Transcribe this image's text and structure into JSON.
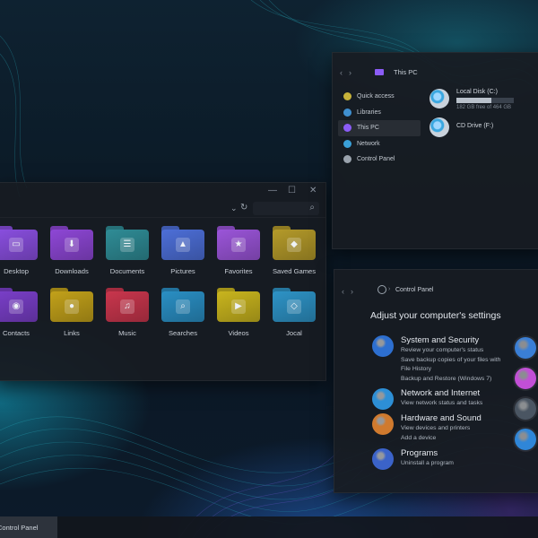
{
  "explorer": {
    "folders": [
      {
        "label": "Desktop",
        "color": "#8a4fe0",
        "glyph": "▭"
      },
      {
        "label": "Downloads",
        "color": "#8e47d6",
        "glyph": "⬇"
      },
      {
        "label": "Documents",
        "color": "#2f8c96",
        "glyph": "☰"
      },
      {
        "label": "Pictures",
        "color": "#4d6fd8",
        "glyph": "▲"
      },
      {
        "label": "Favorites",
        "color": "#9b55d9",
        "glyph": "★"
      },
      {
        "label": "Saved Games",
        "color": "#b49a2a",
        "glyph": "◆"
      },
      {
        "label": "Contacts",
        "color": "#7a3fc9",
        "glyph": "◉"
      },
      {
        "label": "Links",
        "color": "#c2a11a",
        "glyph": "●"
      },
      {
        "label": "Music",
        "color": "#c9364d",
        "glyph": "♫"
      },
      {
        "label": "Searches",
        "color": "#2a8fc4",
        "glyph": "⌕"
      },
      {
        "label": "Videos",
        "color": "#c9b51e",
        "glyph": "▶"
      },
      {
        "label": "Jocal",
        "color": "#2e93c6",
        "glyph": "◇"
      }
    ]
  },
  "thispc": {
    "breadcrumb": "This PC",
    "sidebar": [
      {
        "label": "Quick access",
        "color": "#c7b23a"
      },
      {
        "label": "Libraries",
        "color": "#3f8fcf"
      },
      {
        "label": "This PC",
        "color": "#8b5cf6"
      },
      {
        "label": "Network",
        "color": "#3aa0d8"
      },
      {
        "label": "Control Panel",
        "color": "#9aa3ad"
      }
    ],
    "drives": [
      {
        "name": "Local Disk (C:)",
        "free": "182 GB free of 464 GB",
        "used_fraction": 0.61
      },
      {
        "name": "CD Drive (F:)"
      }
    ]
  },
  "cpanel": {
    "breadcrumb": "Control Panel",
    "heading": "Adjust your computer's settings",
    "categories": [
      {
        "title": "System and Security",
        "color": "#2d6fd0",
        "links": [
          "Review your computer's status",
          "Save backup copies of your files with",
          "File History",
          "Backup and Restore (Windows 7)"
        ]
      },
      {
        "title": "Network and Internet",
        "color": "#2d8fd6",
        "links": [
          "View network status and tasks"
        ]
      },
      {
        "title": "Hardware and Sound",
        "color": "#d07a2e",
        "links": [
          "View devices and printers",
          "Add a device"
        ]
      },
      {
        "title": "Programs",
        "color": "#3b63c9",
        "links": [
          "Uninstall a program"
        ]
      }
    ],
    "side_icons": [
      {
        "name": "user-accounts-icon",
        "color": "#3a7fd6"
      },
      {
        "name": "appearance-icon",
        "color": "#c24fd6"
      },
      {
        "name": "clock-region-icon",
        "color": "#4a5562"
      },
      {
        "name": "ease-of-access-icon",
        "color": "#2f86d8"
      }
    ]
  },
  "taskbar": {
    "item_label": "Control Panel"
  }
}
